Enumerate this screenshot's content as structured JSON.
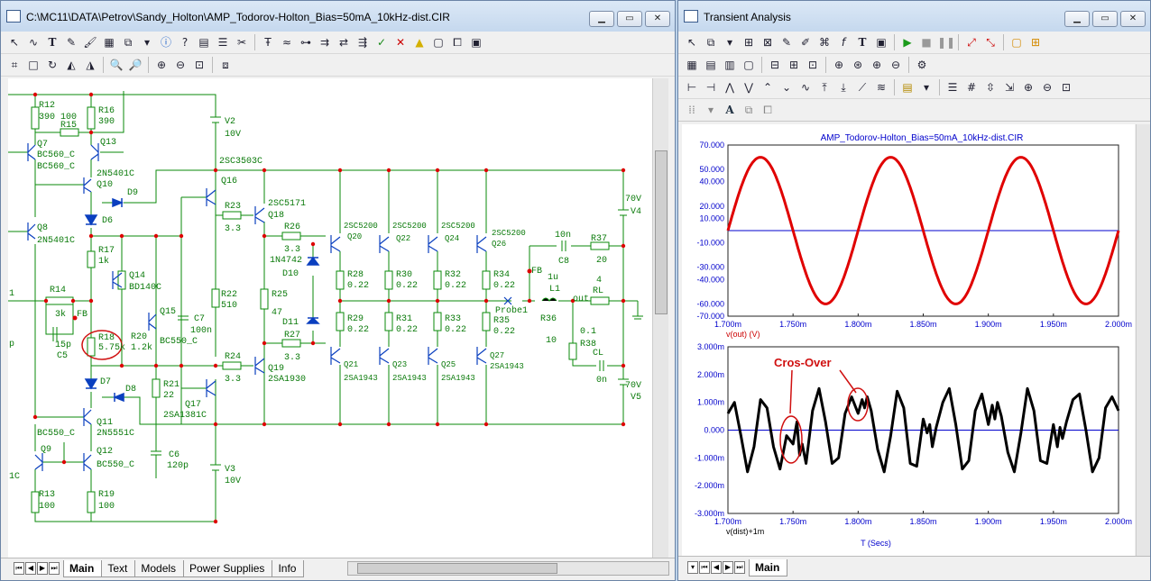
{
  "schematic_window": {
    "title": "C:\\MC11\\DATA\\Petrov\\Sandy_Holton\\AMP_Todorov-Holton_Bias=50mA_10kHz-dist.CIR",
    "tabs": [
      "Main",
      "Text",
      "Models",
      "Power Supplies",
      "Info"
    ],
    "active_tab": "Main",
    "components": {
      "R12": "R12",
      "R12v": "390",
      "R16": "R16",
      "R16v": "390",
      "R15": "R15",
      "R15v": "100",
      "Q7": "Q7",
      "Q7m": "BC560_C",
      "Q13": "Q13",
      "Q13m": "BC560_C",
      "Q13x": "2N5401C",
      "Q10": "Q10",
      "D9": "D9",
      "D6": "D6",
      "Q8": "Q8",
      "Q8m": "2N5401C",
      "R17": "R17",
      "R17v": "1k",
      "Q14": "Q14",
      "Q14m": "BD140C",
      "R14": "R14",
      "R14v": "3k",
      "FB": "FB",
      "C5v": "15p",
      "C5": "C5",
      "R18": "R18",
      "R18v": "5.75k",
      "R20": "R20",
      "R20v": "1.2k",
      "Q15": "Q15",
      "Q15m": "BC550_C",
      "C7": "C7",
      "C7v": "100n",
      "D7": "D7",
      "D8": "D8",
      "R21": "R21",
      "R21v": "22",
      "Q17": "Q17",
      "Q17m": "2SA1381C",
      "C6": "C6",
      "C6v": "120p",
      "Q11": "Q11",
      "Q11m": "2N5551C",
      "Q11x": "BC550_C",
      "Q9": "Q9",
      "Q12": "Q12",
      "Q12m": "BC550_C",
      "R13": "R13",
      "R13v": "100",
      "R19": "R19",
      "R19v": "100",
      "V2": "V2",
      "V2v": "10V",
      "Q16m": "2SC3503C",
      "Q16": "Q16",
      "R23": "R23",
      "R23v": "3.3",
      "Q18m": "2SC5171",
      "Q18": "Q18",
      "R22": "R22",
      "R22v": "510",
      "R24": "R24",
      "R24v": "3.3",
      "Q19": "Q19",
      "Q19m": "2SA1930",
      "V3": "V3",
      "V3v": "10V",
      "R26": "R26",
      "R26v": "3.3",
      "D10m": "1N4742",
      "D10": "D10",
      "R25": "R25",
      "R25v": "47",
      "D11": "D11",
      "R27": "R27",
      "R27v": "3.3",
      "Q20m": "2SC5200",
      "Q20": "Q20",
      "Q22m": "2SC5200",
      "Q22": "Q22",
      "Q24m": "2SC5200",
      "Q24": "Q24",
      "Q26m": "2SC5200",
      "Q26": "Q26",
      "R28": "R28",
      "R28v": "0.22",
      "R30": "R30",
      "R30v": "0.22",
      "R32": "R32",
      "R32v": "0.22",
      "R34": "R34",
      "R34v": "0.22",
      "R29": "R29",
      "R29v": "0.22",
      "R31": "R31",
      "R31v": "0.22",
      "R33": "R33",
      "R33v": "0.22",
      "R35": "R35",
      "R35v": "0.22",
      "Q21": "Q21",
      "Q21m": "2SA1943",
      "Q23": "Q23",
      "Q23m": "2SA1943",
      "Q25": "Q25",
      "Q25m": "2SA1943",
      "Q27": "Q27",
      "Q27m": "2SA1943",
      "Probe1": "Probe1",
      "FB2": "FB",
      "C8v": "10n",
      "C8": "C8",
      "R37": "R37",
      "R37v": "20",
      "L1v": "1u",
      "L1": "L1",
      "RLv": "4",
      "RL": "RL",
      "out": "out",
      "R36": "R36",
      "R36v": "10",
      "R38v": "0.1",
      "R38": "R38",
      "CL": "CL",
      "CLv": "0n",
      "V4v": "70V",
      "V4": "V4",
      "V5v": "70V",
      "V5": "V5",
      "edge1": "1",
      "edgeC": "1C",
      "edgep": "p"
    }
  },
  "analysis_window": {
    "title": "Transient Analysis",
    "tabs": [
      "Main"
    ],
    "active_tab": "Main",
    "plot_title": "AMP_Todorov-Holton_Bias=50mA_10kHz-dist.CIR",
    "top_ylabel": "v(out) (V)",
    "bottom_ylabel": "v(dist)+1m",
    "xlabel": "T (Secs)",
    "annotation": "Cros-Over",
    "x_ticks": [
      "1.700m",
      "1.750m",
      "1.800m",
      "1.850m",
      "1.900m",
      "1.950m",
      "2.000m"
    ],
    "top_y_ticks": [
      "70.000",
      "50.000",
      "40.000",
      "20.000",
      "10.000",
      "-10.000",
      "-30.000",
      "-40.000",
      "-60.000",
      "-70.000"
    ],
    "bottom_y_ticks": [
      "3.000m",
      "2.000m",
      "1.000m",
      "0.000",
      "-1.000m",
      "-2.000m",
      "-3.000m"
    ],
    "colors": {
      "out": "#e00000",
      "dist": "#000000",
      "axis": "#0000cc",
      "annotation": "#d01010"
    }
  },
  "chart_data": [
    {
      "type": "line",
      "title": "AMP_Todorov-Holton_Bias=50mA_10kHz-dist.CIR",
      "xlabel": "T (Secs)",
      "ylabel": "v(out) (V)",
      "xlim": [
        0.0017,
        0.002
      ],
      "ylim": [
        -70,
        70
      ],
      "series": [
        {
          "name": "v(out) (V)",
          "amplitude": 60,
          "frequency_hz": 10000,
          "peak_times_ms": [
            1.725,
            1.825,
            1.925
          ],
          "trough_times_ms": [
            1.775,
            1.875,
            1.975
          ]
        }
      ]
    },
    {
      "type": "line",
      "xlabel": "T (Secs)",
      "ylabel": "v(dist)+1m",
      "xlim": [
        0.0017,
        0.002
      ],
      "ylim": [
        -0.003,
        0.003
      ],
      "series": [
        {
          "name": "v(dist)+1m",
          "x_ms": [
            1.7,
            1.705,
            1.71,
            1.715,
            1.72,
            1.725,
            1.73,
            1.735,
            1.74,
            1.745,
            1.75,
            1.753,
            1.755,
            1.757,
            1.76,
            1.765,
            1.77,
            1.775,
            1.78,
            1.785,
            1.79,
            1.795,
            1.8,
            1.803,
            1.805,
            1.807,
            1.81,
            1.815,
            1.82,
            1.825,
            1.83,
            1.835,
            1.84,
            1.845,
            1.85,
            1.853,
            1.855,
            1.857,
            1.86,
            1.865,
            1.87,
            1.875,
            1.88,
            1.885,
            1.89,
            1.895,
            1.9,
            1.903,
            1.905,
            1.907,
            1.91,
            1.915,
            1.92,
            1.925,
            1.93,
            1.935,
            1.94,
            1.945,
            1.95,
            1.953,
            1.955,
            1.957,
            1.96,
            1.965,
            1.97,
            1.975,
            1.98,
            1.985,
            1.99,
            1.995,
            2.0
          ],
          "y_mv": [
            0.6,
            1.0,
            -0.2,
            -1.5,
            -0.6,
            1.1,
            0.8,
            -0.6,
            -1.4,
            -0.2,
            -0.5,
            0.3,
            -0.9,
            -0.5,
            -1.2,
            0.7,
            1.5,
            0.3,
            -1.2,
            -1.0,
            0.6,
            1.2,
            0.6,
            1.1,
            0.8,
            1.2,
            0.7,
            -0.7,
            -1.5,
            -0.2,
            1.4,
            0.8,
            -1.2,
            -1.3,
            0.4,
            -0.1,
            0.2,
            -0.6,
            0.1,
            1.0,
            1.5,
            0.2,
            -1.4,
            -1.1,
            0.7,
            1.3,
            0.2,
            0.9,
            0.4,
            1.0,
            0.5,
            -0.8,
            -1.5,
            -0.1,
            1.5,
            0.7,
            -1.1,
            -1.2,
            0.2,
            -0.6,
            0.1,
            -0.3,
            0.3,
            1.1,
            1.3,
            0.0,
            -1.5,
            -1.0,
            0.8,
            1.2,
            0.7
          ]
        }
      ]
    }
  ]
}
